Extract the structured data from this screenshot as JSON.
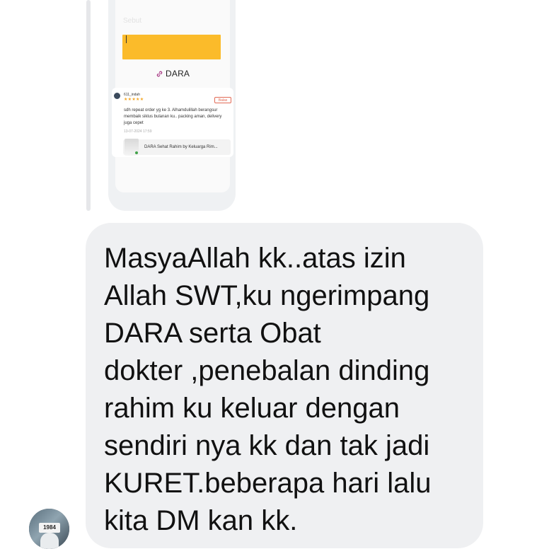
{
  "shared_post": {
    "ghost_label": "Sebut",
    "brand": "DARA",
    "review": {
      "username": "611_indah",
      "stars": "★★★★★",
      "reply_button": "Balas",
      "text": "sdh repeat order yg ke 3. Alhamdulillah berangsur membaik siklus bulanan ku.. packing aman, delivery juga cepet",
      "date": "13-07-2024 17:59",
      "product_title": "DARA Sehat Rahim by Keluarga Rim..."
    }
  },
  "message": {
    "text": "MasyaAllah kk..atas izin\nAllah SWT,ku ngerimpang\nDARA serta Obat\ndokter ,penebalan dinding\nrahim ku keluar dengan\nsendiri nya kk dan tak jadi\nKURET.beberapa hari lalu\nkita DM kan kk."
  },
  "sender": {
    "avatar_label": "1984"
  },
  "colors": {
    "bubble": "#eff0f2",
    "accent_yellow": "#fbbb2a",
    "star": "#f4a623",
    "reply_button": "#e26a55"
  },
  "icons": {
    "brand_link": "link-icon",
    "avatar": "user-avatar"
  }
}
